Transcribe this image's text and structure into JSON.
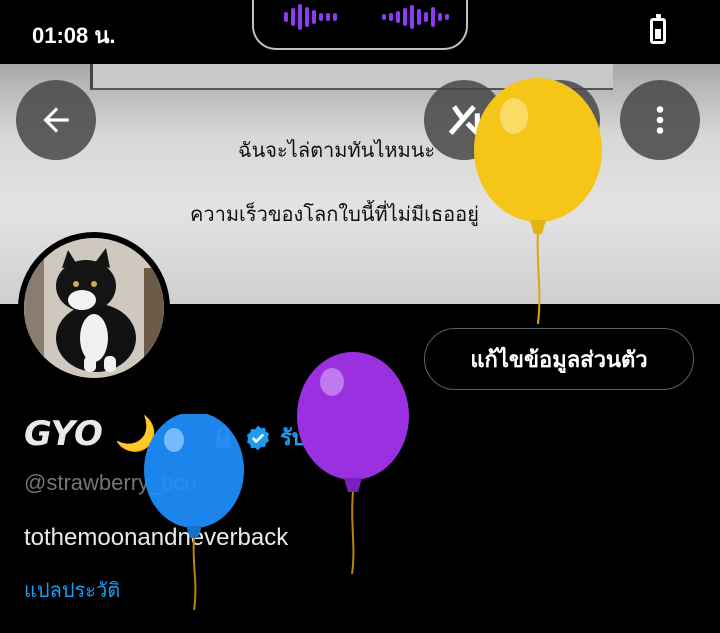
{
  "status_bar": {
    "time": "01:08 น.",
    "battery_icon": "battery-icon",
    "audio_wave_color": "#8b3bf0"
  },
  "header": {
    "back_icon": "arrow-left-icon",
    "grok_icon": "grok-icon",
    "search_icon": "search-icon",
    "more_icon": "more-vertical-icon",
    "banner_text": {
      "line1": "ฉันจะไล่ตามทันไหมนะ",
      "line2": "ความเร็วของโลกใบนี้ที่ไม่มีเธออยู่"
    }
  },
  "profile": {
    "edit_button": "แก้ไขข้อมูลส่วนตัว",
    "display_name": "GYO",
    "moon_emoji": "🌙",
    "verify_label": "รับการยืนยัน",
    "handle": "@strawberry_bcu",
    "bio": "tothemoonandneverback",
    "translate_bio": "แปลประวัติ"
  },
  "colors": {
    "accent": "#1d9bf0",
    "background": "#000000",
    "balloon_yellow": "#f5c518",
    "balloon_purple": "#9b30e0",
    "balloon_blue": "#1e90ff"
  }
}
